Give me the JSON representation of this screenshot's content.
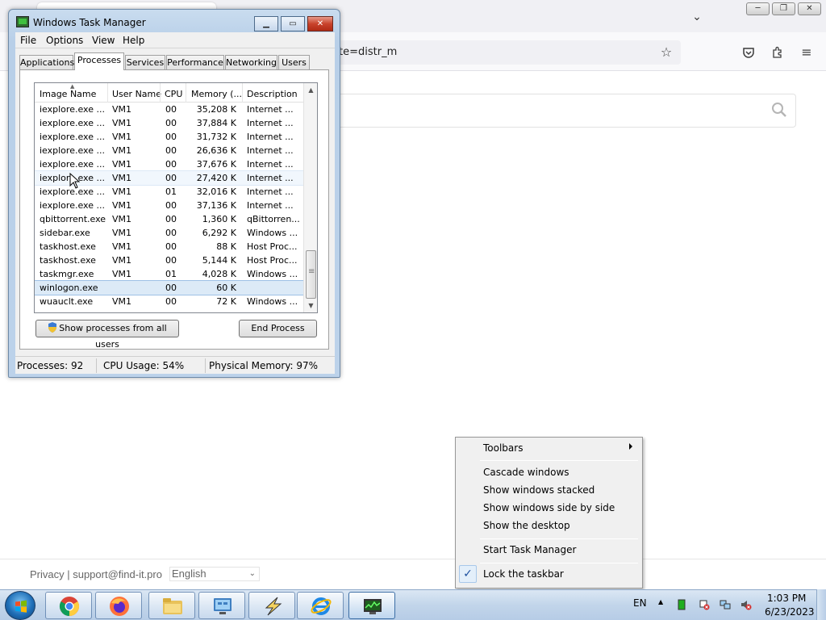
{
  "browser": {
    "url_fragment": "te=distr_m",
    "footer": {
      "links": "Privacy | support@find-it.pro",
      "language": "English"
    }
  },
  "task_manager": {
    "title": "Windows Task Manager",
    "menu": [
      "File",
      "Options",
      "View",
      "Help"
    ],
    "tabs": [
      "Applications",
      "Processes",
      "Services",
      "Performance",
      "Networking",
      "Users"
    ],
    "active_tab": "Processes",
    "columns": [
      "Image Name",
      "User Name",
      "CPU",
      "Memory (...",
      "Description"
    ],
    "processes": [
      {
        "name": "iexplore.exe ...",
        "user": "VM1",
        "cpu": "00",
        "memory": "35,208 K",
        "desc": "Internet ..."
      },
      {
        "name": "iexplore.exe ...",
        "user": "VM1",
        "cpu": "00",
        "memory": "37,884 K",
        "desc": "Internet ..."
      },
      {
        "name": "iexplore.exe ...",
        "user": "VM1",
        "cpu": "00",
        "memory": "31,732 K",
        "desc": "Internet ..."
      },
      {
        "name": "iexplore.exe ...",
        "user": "VM1",
        "cpu": "00",
        "memory": "26,636 K",
        "desc": "Internet ..."
      },
      {
        "name": "iexplore.exe ...",
        "user": "VM1",
        "cpu": "00",
        "memory": "37,676 K",
        "desc": "Internet ..."
      },
      {
        "name": "iexplore.exe ...",
        "user": "VM1",
        "cpu": "00",
        "memory": "27,420 K",
        "desc": "Internet ..."
      },
      {
        "name": "iexplore.exe ...",
        "user": "VM1",
        "cpu": "01",
        "memory": "32,016 K",
        "desc": "Internet ..."
      },
      {
        "name": "iexplore.exe ...",
        "user": "VM1",
        "cpu": "00",
        "memory": "37,136 K",
        "desc": "Internet ..."
      },
      {
        "name": "qbittorrent.exe",
        "user": "VM1",
        "cpu": "00",
        "memory": "1,360 K",
        "desc": "qBittorren..."
      },
      {
        "name": "sidebar.exe",
        "user": "VM1",
        "cpu": "00",
        "memory": "6,292 K",
        "desc": "Windows ..."
      },
      {
        "name": "taskhost.exe",
        "user": "VM1",
        "cpu": "00",
        "memory": "88 K",
        "desc": "Host Proc..."
      },
      {
        "name": "taskhost.exe",
        "user": "VM1",
        "cpu": "00",
        "memory": "5,144 K",
        "desc": "Host Proc..."
      },
      {
        "name": "taskmgr.exe",
        "user": "VM1",
        "cpu": "01",
        "memory": "4,028 K",
        "desc": "Windows ..."
      },
      {
        "name": "winlogon.exe",
        "user": "",
        "cpu": "00",
        "memory": "60 K",
        "desc": ""
      },
      {
        "name": "wuauclt.exe",
        "user": "VM1",
        "cpu": "00",
        "memory": "72 K",
        "desc": "Windows ..."
      }
    ],
    "show_all_button": "Show processes from all users",
    "end_process_button": "End Process",
    "status": {
      "processes": "Processes: 92",
      "cpu": "CPU Usage: 54%",
      "memory": "Physical Memory: 97%"
    }
  },
  "context_menu": {
    "toolbars": "Toolbars",
    "cascade": "Cascade windows",
    "stacked": "Show windows stacked",
    "side_by_side": "Show windows side by side",
    "desktop": "Show the desktop",
    "start_tm": "Start Task Manager",
    "lock": "Lock the taskbar"
  },
  "taskbar": {
    "apps": [
      "chrome-icon",
      "firefox-icon",
      "explorer-icon",
      "control-panel-icon",
      "winamp-icon",
      "ie-icon",
      "task-manager-icon"
    ],
    "language": "EN",
    "time": "1:03 PM",
    "date": "6/23/2023"
  }
}
